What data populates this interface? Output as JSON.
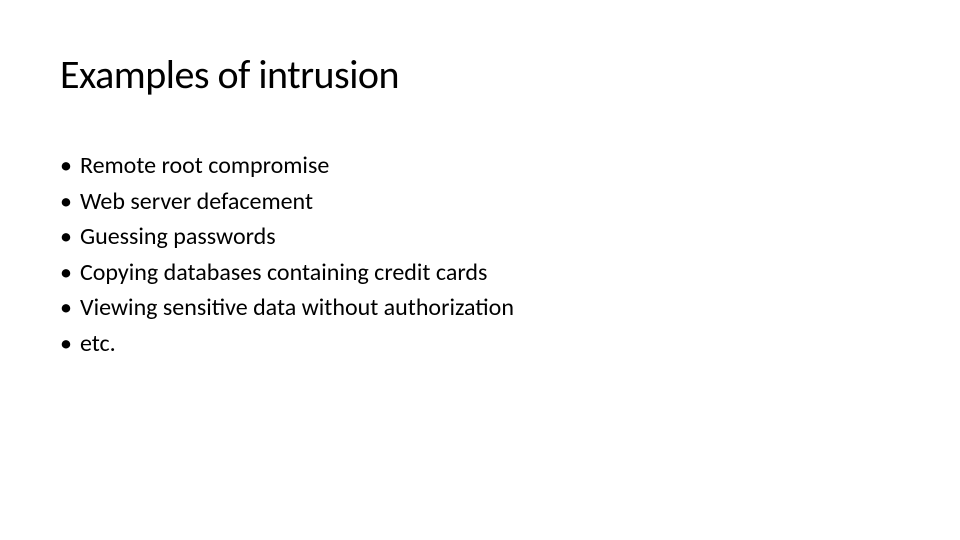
{
  "slide": {
    "title": "Examples of intrusion",
    "bullets": [
      "Remote root compromise",
      "Web server defacement",
      "Guessing passwords",
      "Copying databases containing credit cards",
      "Viewing sensitive data without authorization",
      "etc."
    ]
  }
}
